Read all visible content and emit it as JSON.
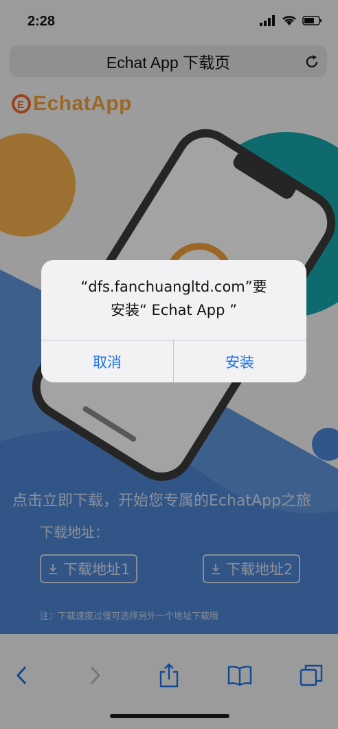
{
  "status_bar": {
    "time": "2:28"
  },
  "browser": {
    "page_title": "Echat App 下载页",
    "reload_icon": "reload-icon"
  },
  "page": {
    "logo_text": "EchatApp",
    "tagline": "点击立即下载，开始您专属的EchatApp之旅",
    "download_label": "下载地址：",
    "download_buttons": [
      "下载地址1",
      "下载地址2"
    ],
    "note": "注：下载速度过慢可选择另外一个地址下载哦"
  },
  "alert": {
    "line1": "“dfs.fanchuangltd.com”要",
    "line2": "安装“ Echat App ”",
    "cancel_label": "取消",
    "install_label": "安装",
    "button_color": "#1a73e8"
  },
  "toolbar": {
    "icons": [
      "back-icon",
      "forward-icon",
      "share-icon",
      "bookmarks-icon",
      "tabs-icon"
    ]
  }
}
